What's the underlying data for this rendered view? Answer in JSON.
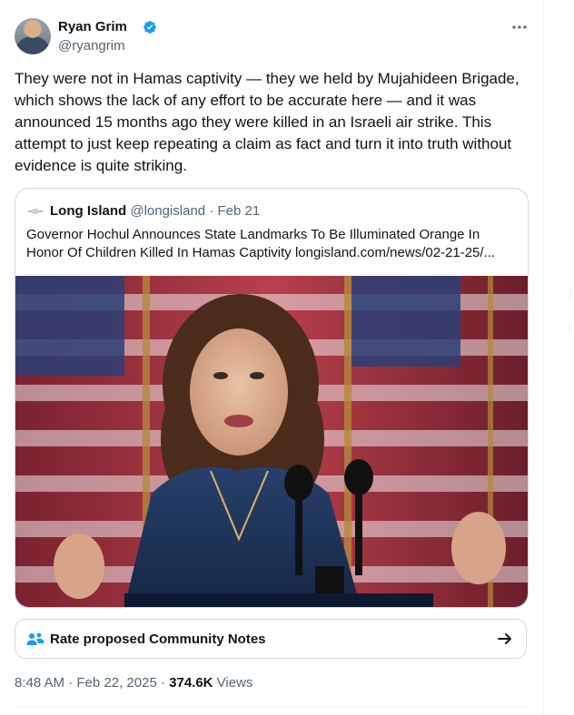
{
  "author": {
    "name": "Ryan Grim",
    "handle": "@ryangrim",
    "verified_icon": "verified-badge-icon",
    "more_icon": "more-options-icon",
    "verified_color": "#1d9bf0"
  },
  "tweet": {
    "text": "They were not in Hamas captivity — they we held by Mujahideen Brigade, which shows the lack of any effort to be accurate here — and it was announced 15 months ago they were killed in an Israeli air strike. This attempt to just keep repeating a claim as fact and turn it into truth without evidence is quite striking."
  },
  "quote": {
    "name": "Long Island",
    "handle": "@longisland",
    "separator": " · ",
    "date": "Feb 21",
    "text": "Governor Hochul Announces State Landmarks To Be Illuminated Orange In Honor Of Children Killed In Hamas Captivity longisland.com/news/02-21-25/...",
    "image": "photo of woman speaking at podium in front of american flags"
  },
  "community_notes": {
    "icon": "people-icon",
    "label": "Rate proposed Community Notes",
    "arrow_icon": "arrow-right-icon"
  },
  "meta": {
    "time": "8:48 AM",
    "dot1": " · ",
    "date": "Feb 22, 2025",
    "dot2": " · ",
    "views_count": "374.6K",
    "views_label": " Views"
  }
}
